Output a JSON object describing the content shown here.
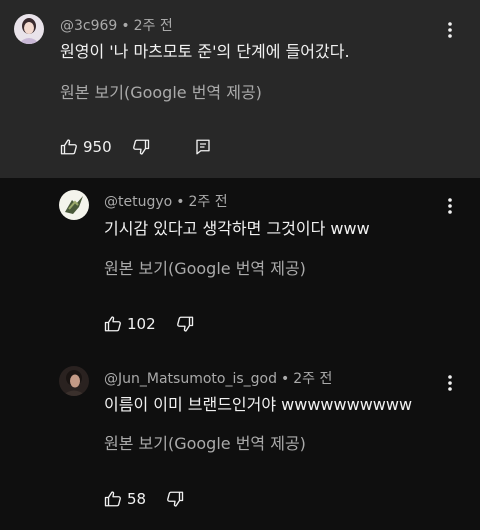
{
  "comments": [
    {
      "handle": "@3c969",
      "separator": "•",
      "time": "2주 전",
      "text": "원영이 '나 마츠모토 준'의 단계에 들어갔다.",
      "translate_label": "원본 보기(Google 번역 제공)",
      "likes": "950",
      "avatar_icon": "profile-photo-avatar"
    },
    {
      "handle": "@tetugyo",
      "separator": "•",
      "time": "2주 전",
      "text": "기시감 있다고 생각하면 그것이다 www",
      "translate_label": "원본 보기(Google 번역 제공)",
      "likes": "102",
      "avatar_icon": "bird-avatar"
    },
    {
      "handle": "@Jun_Matsumoto_is_god",
      "separator": "•",
      "time": "2주 전",
      "text": "이름이 이미 브랜드인거야 wwwwwwwwww",
      "translate_label": "원본 보기(Google 번역 제공)",
      "likes": "58",
      "avatar_icon": "profile-photo-avatar"
    }
  ],
  "colors": {
    "highlighted_bg": "#282828",
    "page_bg": "#0f0f0f",
    "primary_text": "#f1f1f1",
    "secondary_text": "#aaaaaa"
  }
}
